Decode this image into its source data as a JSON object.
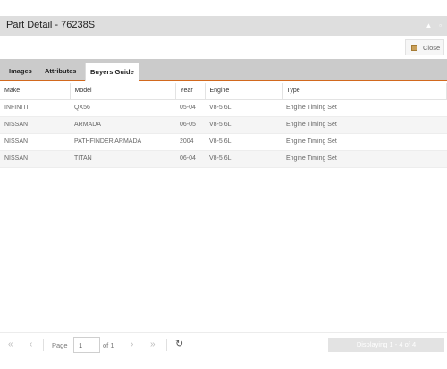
{
  "window": {
    "title": "Part Detail - 76238S",
    "collapse_glyph": "▲",
    "maximize_glyph": "▫"
  },
  "toolbar": {
    "close_label": "Close"
  },
  "tabs": [
    {
      "label": "Images"
    },
    {
      "label": "Attributes"
    },
    {
      "label": "Buyers Guide"
    }
  ],
  "grid": {
    "columns": [
      "Make",
      "Model",
      "Year",
      "Engine",
      "Type"
    ],
    "rows": [
      {
        "make": "INFINITI",
        "model": "QX56",
        "year": "05-04",
        "engine": "V8-5.6L",
        "type": "Engine Timing Set"
      },
      {
        "make": "NISSAN",
        "model": "ARMADA",
        "year": "06-05",
        "engine": "V8-5.6L",
        "type": "Engine Timing Set"
      },
      {
        "make": "NISSAN",
        "model": "PATHFINDER ARMADA",
        "year": "2004",
        "engine": "V8-5.6L",
        "type": "Engine Timing Set"
      },
      {
        "make": "NISSAN",
        "model": "TITAN",
        "year": "06-04",
        "engine": "V8-5.6L",
        "type": "Engine Timing Set"
      }
    ]
  },
  "pager": {
    "first_glyph": "«",
    "prev_glyph": "‹",
    "next_glyph": "›",
    "last_glyph": "»",
    "refresh_glyph": "↻",
    "page_label": "Page",
    "page_value": "1",
    "of_label": "of 1",
    "display_text": "Displaying 1 - 4 of 4"
  }
}
